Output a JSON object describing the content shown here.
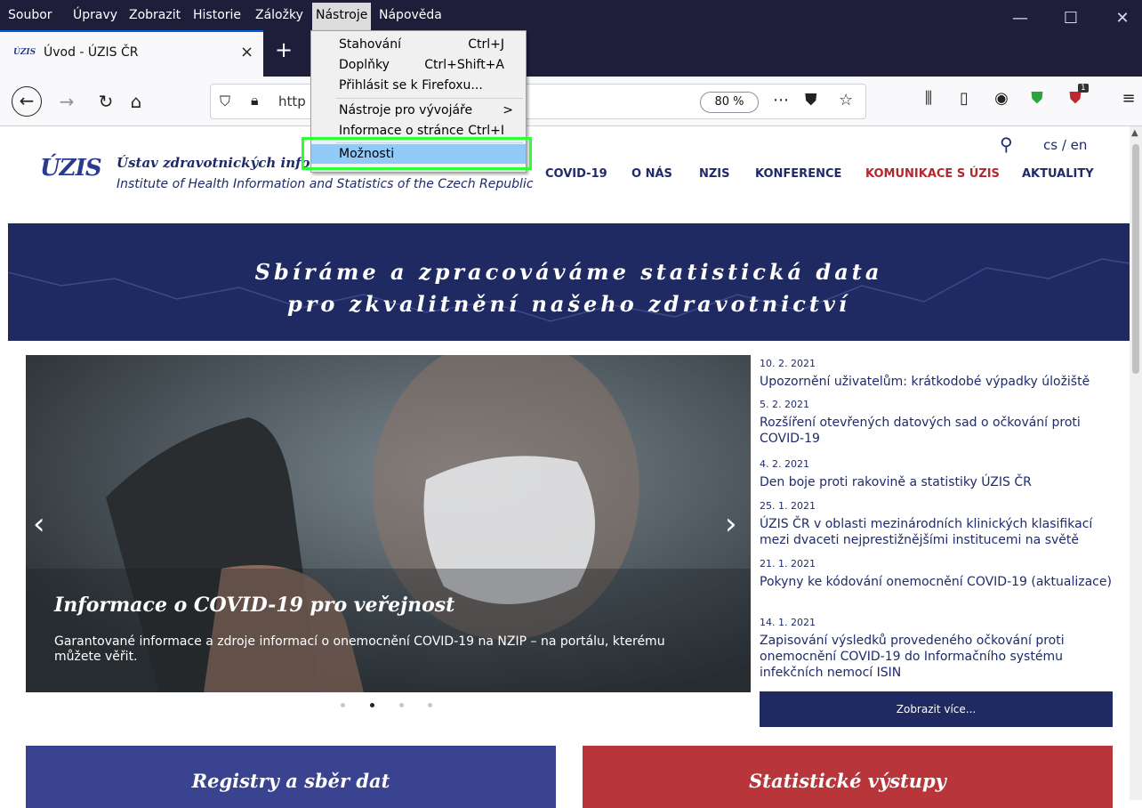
{
  "menubar": {
    "items": [
      "Soubor",
      "Úpravy",
      "Zobrazit",
      "Historie",
      "Záložky",
      "Nástroje",
      "Nápověda"
    ],
    "active": "Nástroje"
  },
  "tab": {
    "favicon_text": "ÚZIS",
    "title": "Úvod - ÚZIS ČR",
    "close": "×",
    "new_tab": "+"
  },
  "url": {
    "text": "http",
    "zoom": "80 %"
  },
  "toolbar_badge": "1",
  "tools_menu": {
    "items": [
      {
        "label": "Stahování",
        "shortcut": "Ctrl+J"
      },
      {
        "label": "Doplňky",
        "shortcut": "Ctrl+Shift+A"
      },
      {
        "label": "Přihlásit se k Firefoxu...",
        "shortcut": ""
      },
      {
        "label": "Nástroje pro vývojáře",
        "shortcut": ">"
      },
      {
        "label": "Informace o stránce",
        "shortcut": "Ctrl+I"
      },
      {
        "label": "Možnosti",
        "shortcut": ""
      }
    ],
    "selected": "Možnosti"
  },
  "site": {
    "logo": "ÚZIS",
    "org_cs": "Ústav zdravotnických informací a statistiky ČR",
    "org_en": "Institute of Health Information and Statistics of the Czech Republic",
    "lang": "cs / en",
    "nav": [
      "COVID-19",
      "O NÁS",
      "NZIS",
      "KONFERENCE",
      "KOMUNIKACE S ÚZIS",
      "AKTUALITY"
    ],
    "hero_line1": "Sbíráme a zpracováváme statistická data",
    "hero_line2": "pro zkvalitnění našeho zdravotnictví",
    "slide_title": "Informace o COVID-19 pro veřejnost",
    "slide_text": "Garantované informace a zdroje informací o onemocnění COVID-19 na NZIP – na portálu, kterému můžete věřit.",
    "slide_prev": "‹",
    "slide_next": "›",
    "news": [
      {
        "date": "10. 2. 2021",
        "title": "Upozornění uživatelům: krátkodobé výpadky úložiště"
      },
      {
        "date": "5. 2. 2021",
        "title": "Rozšíření otevřených datových sad o očkování proti COVID-19"
      },
      {
        "date": "4. 2. 2021",
        "title": "Den boje proti rakovině a statistiky ÚZIS ČR"
      },
      {
        "date": "25. 1. 2021",
        "title": "ÚZIS ČR v oblasti mezinárodních klinických klasifikací mezi dvaceti nejprestižnějšími institucemi na světě"
      },
      {
        "date": "21. 1. 2021",
        "title": "Pokyny ke kódování onemocnění COVID-19 (aktualizace)"
      },
      {
        "date": "14. 1. 2021",
        "title": "Zapisování výsledků provedeného očkování proti onemocnění COVID-19 do Informačního systému infekčních nemocí ISIN"
      }
    ],
    "more": "Zobrazit více...",
    "card_left": "Registry a sběr dat",
    "card_right": "Statistické výstupy"
  }
}
